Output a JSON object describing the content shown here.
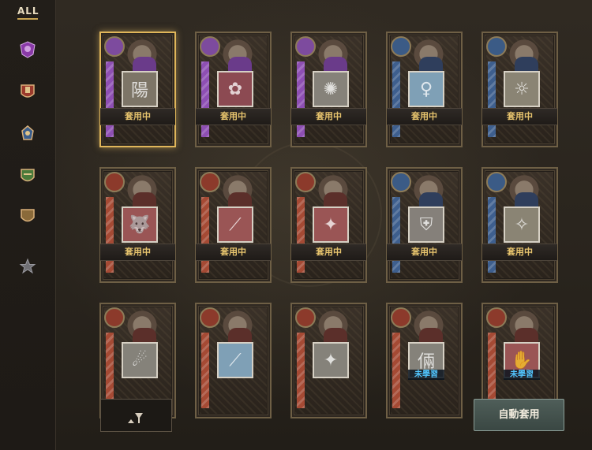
{
  "sidebar": {
    "all_label": "ALL",
    "items": [
      {
        "icon": "purple-crest-icon",
        "color": "#8a3aa8"
      },
      {
        "icon": "red-crest-icon",
        "color": "#9b3a2c"
      },
      {
        "icon": "blue-crest-icon",
        "color": "#3b5e8c"
      },
      {
        "icon": "green-crest-icon",
        "color": "#4a7a3a"
      },
      {
        "icon": "bronze-crest-icon",
        "color": "#8a6a3a"
      },
      {
        "icon": "star-icon",
        "color": "#6f6f74"
      }
    ]
  },
  "cards": [
    {
      "glyph": "陽",
      "status": "套用中",
      "class": "purple",
      "skill_color": "#7d7567",
      "selected": true
    },
    {
      "glyph": "✿",
      "status": "套用中",
      "class": "purple",
      "skill_color": "#8c4a52",
      "selected": false
    },
    {
      "glyph": "✺",
      "status": "套用中",
      "class": "purple",
      "skill_color": "#86827a",
      "selected": false
    },
    {
      "glyph": "♀",
      "status": "套用中",
      "class": "blue",
      "skill_color": "#7fa0b6",
      "selected": false
    },
    {
      "glyph": "☼",
      "status": "套用中",
      "class": "blue",
      "skill_color": "#8a8474",
      "selected": false
    },
    {
      "glyph": "🐺",
      "status": "套用中",
      "class": "red",
      "skill_color": "#9a5555",
      "selected": false
    },
    {
      "glyph": "⟋",
      "status": "套用中",
      "class": "red",
      "skill_color": "#9a5555",
      "selected": false
    },
    {
      "glyph": "✦",
      "status": "套用中",
      "class": "red",
      "skill_color": "#9a5555",
      "selected": false
    },
    {
      "glyph": "⛨",
      "status": "套用中",
      "class": "blue",
      "skill_color": "#85807a",
      "selected": false
    },
    {
      "glyph": "✧",
      "status": "套用中",
      "class": "blue",
      "skill_color": "#8a8474",
      "selected": false
    },
    {
      "glyph": "☄",
      "status": "",
      "class": "red",
      "skill_color": "#85827a",
      "selected": false
    },
    {
      "glyph": "⟋",
      "status": "",
      "class": "red",
      "skill_color": "#7fa0b6",
      "selected": false
    },
    {
      "glyph": "✦",
      "status": "",
      "class": "red",
      "skill_color": "#85827a",
      "selected": false
    },
    {
      "glyph": "倆",
      "status": "未學習",
      "class": "red",
      "skill_color": "#85827a",
      "selected": false
    },
    {
      "glyph": "✋",
      "status": "未學習",
      "class": "red",
      "skill_color": "#9a5555",
      "selected": false
    }
  ],
  "footer": {
    "filter_icon": "filter-funnel-icon",
    "auto_apply_label": "自動套用"
  },
  "colors": {
    "equipped_text": "#e6c36d",
    "unlearned_text": "#52c6ff",
    "selected_border": "#e0b65a"
  }
}
